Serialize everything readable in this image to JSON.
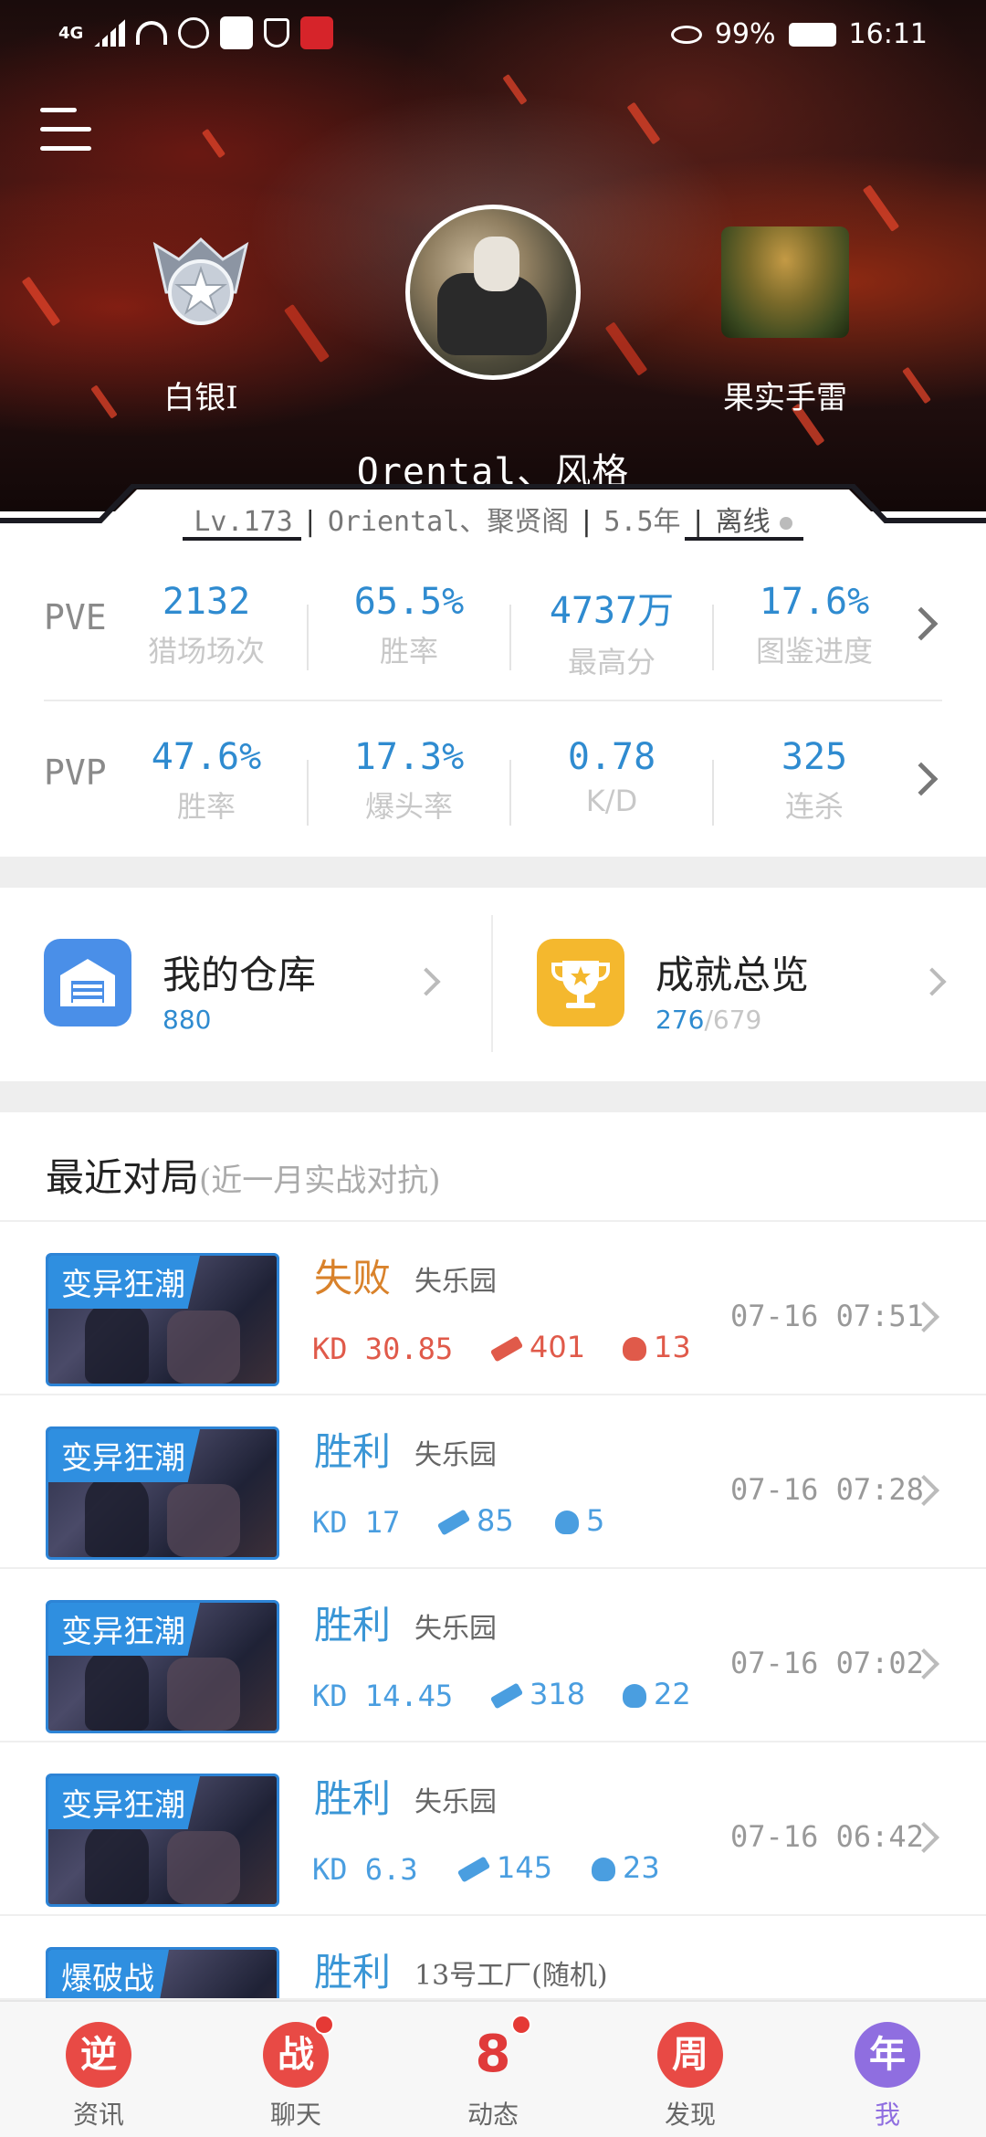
{
  "status_bar": {
    "network": "4G",
    "battery": "99%",
    "time": "16:11"
  },
  "profile": {
    "rank_label": "白银I",
    "nickname": "Orental、风格",
    "item_label": "果实手雷",
    "info": {
      "level": "Lv.173",
      "guild": "Oriental、聚贤阁",
      "years": "5.5年",
      "status": "离线"
    }
  },
  "stats": {
    "pve": {
      "mode": "PVE",
      "items": [
        {
          "value": "2132",
          "label": "猎场场次"
        },
        {
          "value": "65.5%",
          "label": "胜率"
        },
        {
          "value": "4737万",
          "label": "最高分"
        },
        {
          "value": "17.6%",
          "label": "图鉴进度"
        }
      ]
    },
    "pvp": {
      "mode": "PVP",
      "items": [
        {
          "value": "47.6%",
          "label": "胜率"
        },
        {
          "value": "17.3%",
          "label": "爆头率"
        },
        {
          "value": "0.78",
          "label": "K/D"
        },
        {
          "value": "325",
          "label": "连杀"
        }
      ]
    }
  },
  "shortcuts": {
    "warehouse": {
      "title": "我的仓库",
      "count": "880"
    },
    "achievements": {
      "title": "成就总览",
      "done": "276",
      "total": "/679"
    }
  },
  "recent": {
    "title": "最近对局",
    "subtitle": "(近一月实战对抗)",
    "matches": [
      {
        "mode": "变异狂潮",
        "result": "失败",
        "map": "失乐园",
        "kd": "KD 30.85",
        "kills": "401",
        "headshots": "13",
        "time": "07-16  07:51"
      },
      {
        "mode": "变异狂潮",
        "result": "胜利",
        "map": "失乐园",
        "kd": "KD 17",
        "kills": "85",
        "headshots": "5",
        "time": "07-16  07:28"
      },
      {
        "mode": "变异狂潮",
        "result": "胜利",
        "map": "失乐园",
        "kd": "KD 14.45",
        "kills": "318",
        "headshots": "22",
        "time": "07-16  07:02"
      },
      {
        "mode": "变异狂潮",
        "result": "胜利",
        "map": "失乐园",
        "kd": "KD 6.3",
        "kills": "145",
        "headshots": "23",
        "time": "07-16  06:42"
      },
      {
        "mode": "爆破战",
        "result": "胜利",
        "map": "13号工厂(随机)"
      }
    ]
  },
  "bottom_nav": [
    {
      "icon": "逆",
      "label": "资讯"
    },
    {
      "icon": "战",
      "label": "聊天"
    },
    {
      "icon": "8",
      "label": "动态"
    },
    {
      "icon": "周",
      "label": "发现"
    },
    {
      "icon": "年",
      "label": "我"
    }
  ],
  "colors": {
    "accent_blue": "#2f8bd0",
    "lose_orange": "#d9822b",
    "win_blue": "#3a96d6",
    "kill_red": "#e05a4a",
    "badge_red": "#e53935"
  }
}
